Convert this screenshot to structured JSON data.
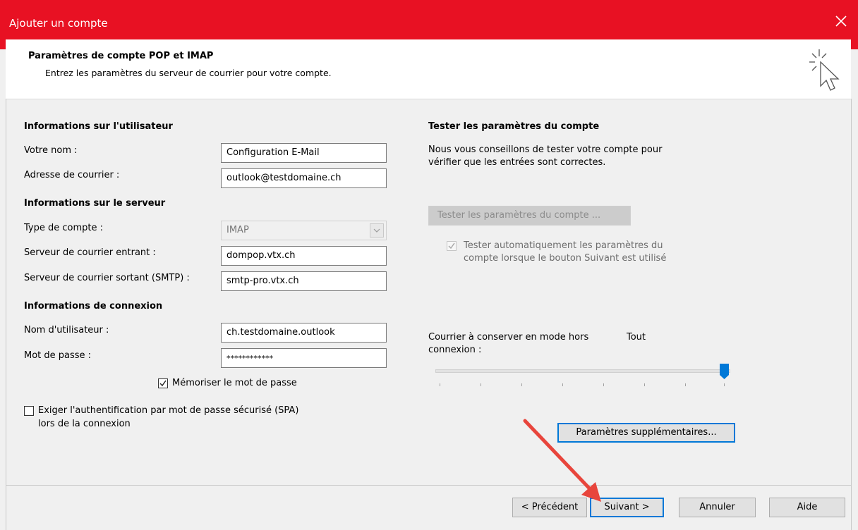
{
  "window": {
    "title": "Ajouter un compte",
    "close_icon": "close-icon"
  },
  "header": {
    "title": "Paramètres de compte POP et IMAP",
    "subtitle": "Entrez les paramètres du serveur de courrier pour votre compte.",
    "icon": "cursor-click-icon"
  },
  "user_info": {
    "heading": "Informations sur l'utilisateur",
    "name_label": "Votre nom :",
    "name_value": "Configuration E-Mail",
    "email_label": "Adresse de courrier :",
    "email_value": "outlook@testdomaine.ch"
  },
  "server_info": {
    "heading": "Informations sur le serveur",
    "type_label": "Type de compte :",
    "type_value": "IMAP",
    "incoming_label": "Serveur de courrier entrant :",
    "incoming_value": "dompop.vtx.ch",
    "outgoing_label": "Serveur de courrier sortant (SMTP) :",
    "outgoing_value": "smtp-pro.vtx.ch"
  },
  "login_info": {
    "heading": "Informations de connexion",
    "user_label": "Nom d'utilisateur :",
    "user_value": "ch.testdomaine.outlook",
    "password_label": "Mot de passe :",
    "password_value": "************",
    "remember_label": "Mémoriser le mot de passe",
    "remember_checked": true,
    "spa_label_1": "Exiger l'authentification par mot de passe sécurisé (SPA)",
    "spa_label_2": "lors de la connexion",
    "spa_checked": false
  },
  "test": {
    "heading": "Tester les paramètres du compte",
    "desc_1": "Nous vous conseillons de tester votre compte pour",
    "desc_2": "vérifier que les entrées sont correctes.",
    "button": "Tester les paramètres du compte ...",
    "auto_label_1": "Tester automatiquement les paramètres du",
    "auto_label_2": "compte lorsque le bouton Suivant est utilisé",
    "auto_checked": true
  },
  "offline": {
    "label_1": "Courrier à conserver en mode hors connexion :",
    "label_1a": "Courrier à conserver en mode hors",
    "label_1b": "connexion :",
    "value": "Tout",
    "slider_level": 1.0
  },
  "more_settings_button": "Paramètres supplémentaires...",
  "footer": {
    "prev": "< Précédent",
    "next": "Suivant >",
    "cancel": "Annuler",
    "help": "Aide"
  },
  "colors": {
    "titlebar": "#e81123",
    "accent": "#0078d7",
    "annotation_arrow": "#e8453c"
  }
}
